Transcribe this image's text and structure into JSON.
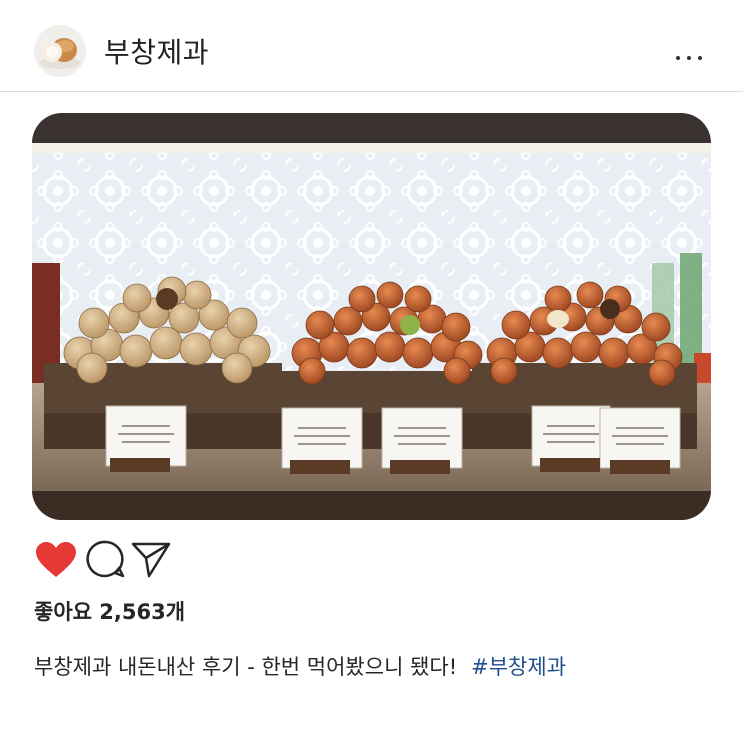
{
  "post": {
    "username": "부창제과",
    "avatar_icon": "bread-icon",
    "more_icon": "more-horizontal-icon",
    "image_description_icon": "bakery-display-photo",
    "likes_text": "좋아요 2,563개",
    "caption_text": "부창제과 내돈내산 후기 - 한번 먹어봤으니 됐다!",
    "hashtag": "#부창제과"
  },
  "actions": {
    "like_icon": "heart-icon",
    "comment_icon": "comment-icon",
    "share_icon": "send-icon",
    "like_color": "#e53935"
  },
  "colors": {
    "hashtag": "#1f4f8e",
    "text": "#262626",
    "divider": "#dbdbdb"
  }
}
